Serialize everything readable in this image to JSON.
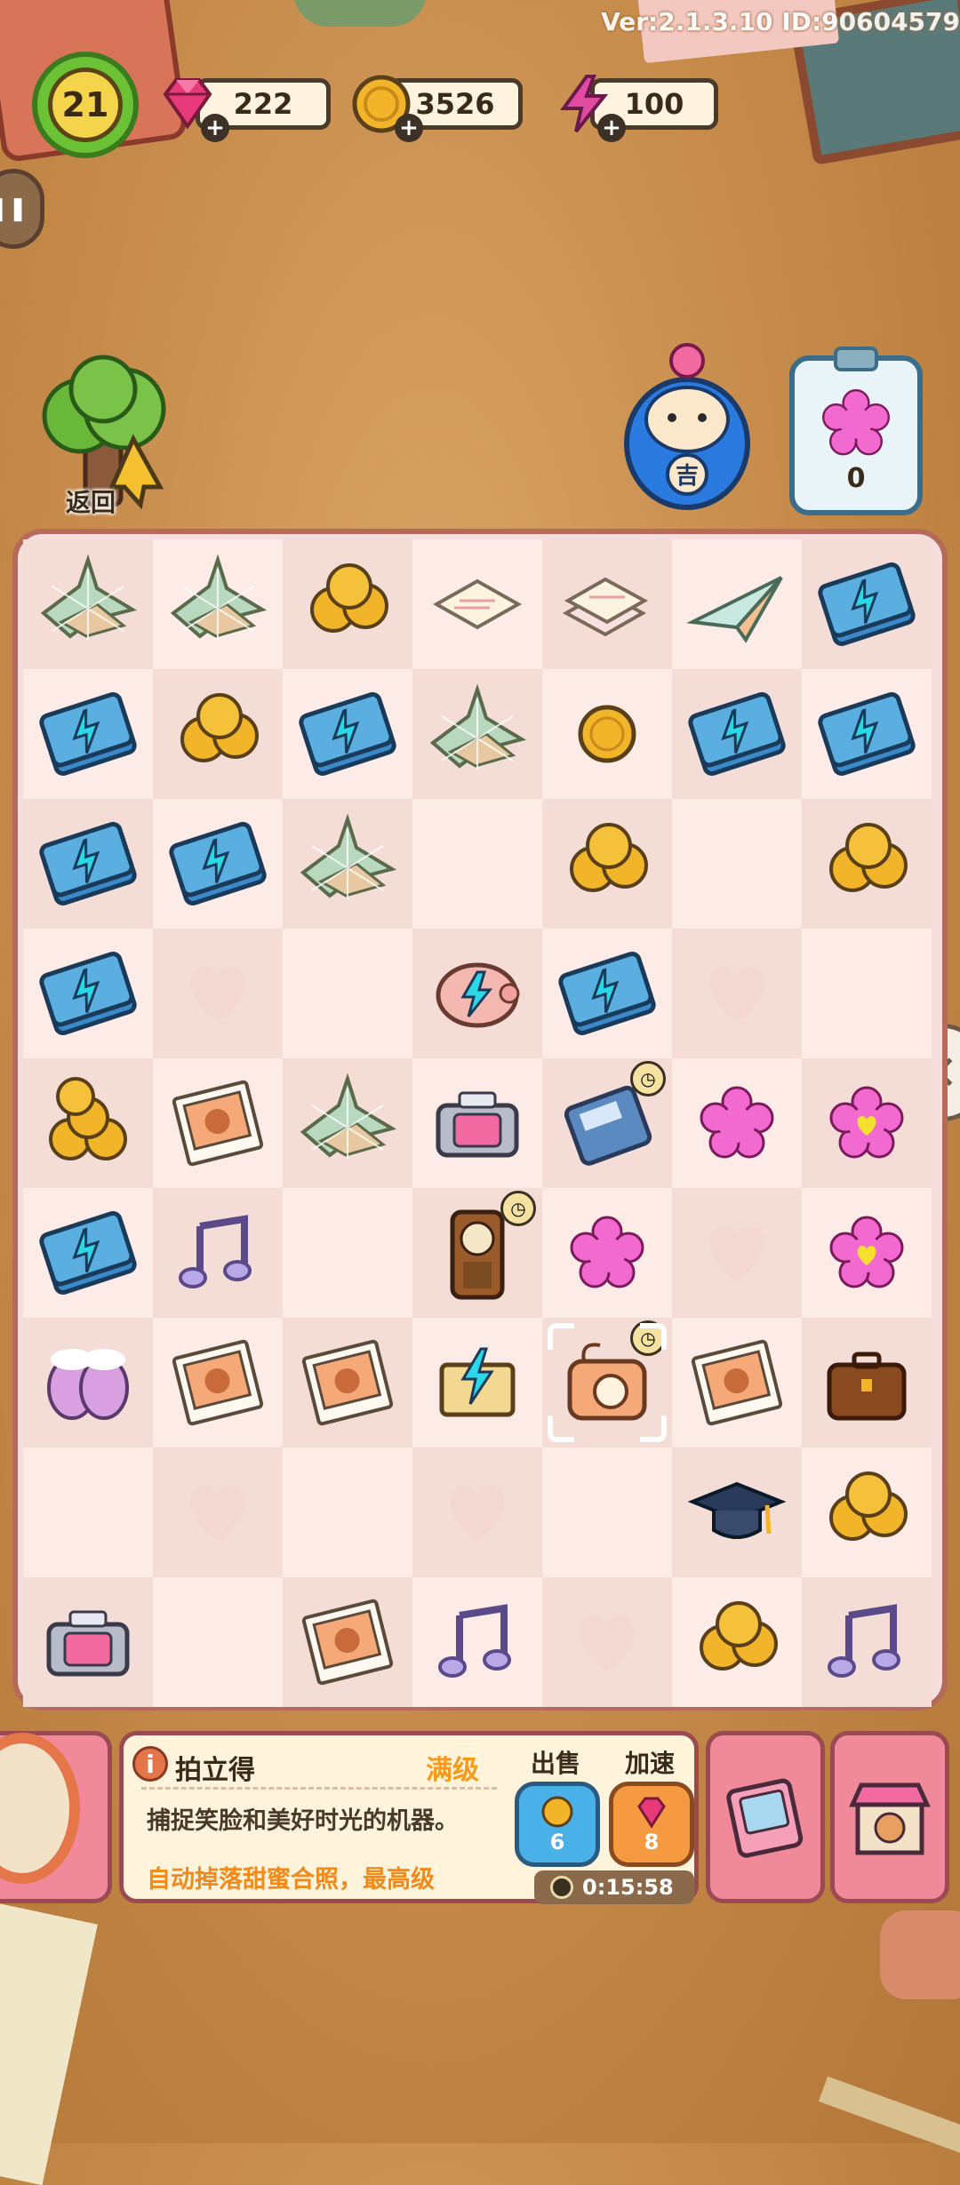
{
  "topbar": {
    "version": "Ver:2.1.3.10 ID:90604579",
    "level": "21",
    "gems": "222",
    "coins": "3526",
    "energy": "100"
  },
  "nav": {
    "back_label": "返回",
    "clipboard_count": "0"
  },
  "board": {
    "rows": [
      [
        "crane-web",
        "crane-web",
        "coins-3",
        "letter",
        "letters",
        "paper-plane",
        "book"
      ],
      [
        "book",
        "coins-3",
        "book",
        "crane-web",
        "coin",
        "book",
        "book"
      ],
      [
        "book",
        "book",
        "crane-web",
        "",
        "coins-3",
        "",
        "coins-3"
      ],
      [
        "book",
        "heart",
        "",
        "piggy",
        "book",
        "heart",
        ""
      ],
      [
        "coins-stack",
        "photo",
        "crane-web",
        "instant-printer",
        "pos-machine",
        "flower",
        "flower-heart"
      ],
      [
        "book",
        "note",
        "",
        "clock",
        "flower",
        "heart",
        "flower-heart"
      ],
      [
        "mittens",
        "photo",
        "photo",
        "piano",
        "camera",
        "photo",
        "suitcase"
      ],
      [
        "",
        "heart",
        "",
        "heart",
        "",
        "grad-cap",
        "coins-3"
      ],
      [
        "instant-printer",
        "",
        "photo",
        "note",
        "heart",
        "coins-3",
        "note"
      ]
    ],
    "timers": [
      [
        4,
        4
      ],
      [
        5,
        3
      ],
      [
        6,
        4
      ]
    ],
    "selected": [
      6,
      4
    ]
  },
  "info": {
    "title": "拍立得",
    "level": "满级",
    "description": "捕捉笑脸和美好时光的机器。",
    "drop": "自动掉落甜蜜合照，最高级",
    "sell_label": "出售",
    "speed_label": "加速",
    "sell_price": "6",
    "speed_price": "8",
    "timer": "0:15:58"
  },
  "colors": {
    "gem": "#e83a7a",
    "coin": "#f2b52a",
    "energy": "#e04aa0",
    "level_ring": "#6ac234",
    "board_border": "#b56a5a"
  }
}
